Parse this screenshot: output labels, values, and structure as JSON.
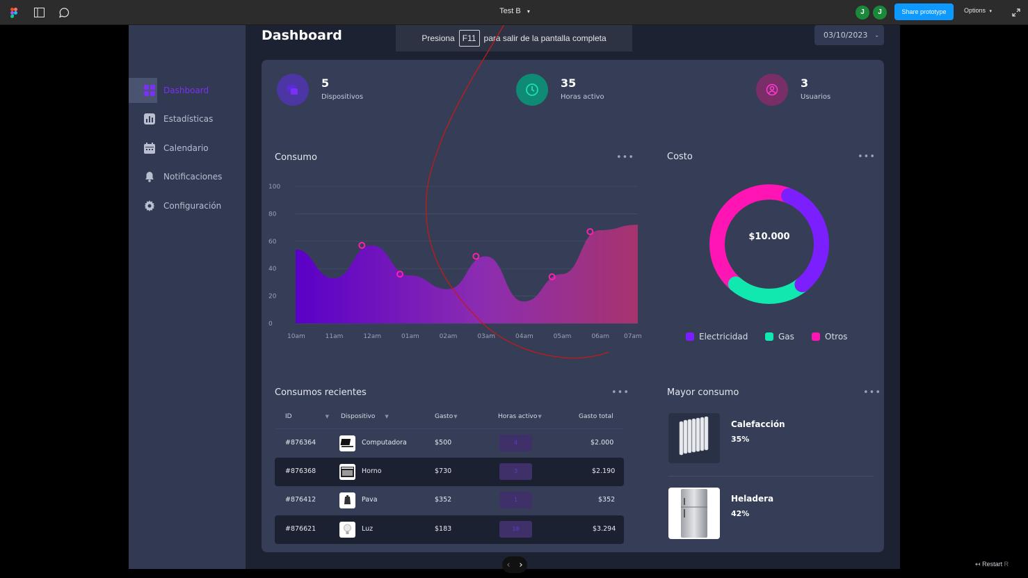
{
  "figma": {
    "file_title": "Test B",
    "share_label": "Share prototype",
    "options_label": "Options",
    "avatars": [
      "J",
      "J"
    ],
    "restart_label": "Restart",
    "restart_key": "R"
  },
  "fullscreen_toast": {
    "before": "Presiona",
    "key": "F11",
    "after": "para salir de la pantalla completa"
  },
  "sidebar": {
    "items": [
      {
        "label": "Dashboard",
        "icon": "grid-icon",
        "active": true
      },
      {
        "label": "Estadísticas",
        "icon": "bar-chart-icon"
      },
      {
        "label": "Calendario",
        "icon": "calendar-icon"
      },
      {
        "label": "Notificaciones",
        "icon": "bell-icon"
      },
      {
        "label": "Configuración",
        "icon": "gear-icon"
      }
    ]
  },
  "header": {
    "title": "Dashboard",
    "date": "03/10/2023"
  },
  "stats": [
    {
      "value": "5",
      "label": "Dispositivos",
      "icon": "devices-icon",
      "color": "#5a2bd6"
    },
    {
      "value": "35",
      "label": "Horas activo",
      "icon": "clock-icon",
      "color": "#16c79a"
    },
    {
      "value": "3",
      "label": "Usuarios",
      "icon": "user-icon",
      "color": "#c11e9d"
    }
  ],
  "consumo": {
    "title": "Consumo",
    "more": "•••"
  },
  "costo": {
    "title": "Costo",
    "more": "•••",
    "total": "$10.000"
  },
  "recientes": {
    "title": "Consumos recientes",
    "more": "•••",
    "headers": [
      "ID",
      "Dispositivo",
      "Gasto",
      "Horas activo",
      "Gasto total"
    ],
    "rows": [
      {
        "id": "#876364",
        "device": "Computadora",
        "gasto": "$500",
        "horas": "4",
        "total": "$2.000",
        "icon": "laptop-icon"
      },
      {
        "id": "#876368",
        "device": "Horno",
        "gasto": "$730",
        "horas": "3",
        "total": "$2.190",
        "icon": "oven-icon"
      },
      {
        "id": "#876412",
        "device": "Pava",
        "gasto": "$352",
        "horas": "1",
        "total": "$352",
        "icon": "kettle-icon"
      },
      {
        "id": "#876621",
        "device": "Luz",
        "gasto": "$183",
        "horas": "18",
        "total": "$3.294",
        "icon": "bulb-icon"
      }
    ]
  },
  "mayor": {
    "title": "Mayor consumo",
    "more": "•••",
    "items": [
      {
        "name": "Calefacción",
        "pct": "35%",
        "icon": "radiator-icon"
      },
      {
        "name": "Heladera",
        "pct": "42%",
        "icon": "fridge-icon"
      }
    ]
  },
  "colors": {
    "accent_purple": "#7b2ff7",
    "electricidad": "#7b1fff",
    "gas": "#11e8b0",
    "otros": "#ff15b4",
    "line_points": "#ff1fb0"
  },
  "chart_data": [
    {
      "type": "area",
      "title": "Consumo",
      "x": [
        "10am",
        "11am",
        "12am",
        "01am",
        "02am",
        "03am",
        "04am",
        "05am",
        "06am",
        "07am"
      ],
      "series": [
        {
          "values": [
            54,
            33,
            57,
            35,
            25,
            49,
            16,
            36,
            68,
            72
          ]
        }
      ],
      "markers": [
        {
          "x": "12am",
          "y": 57
        },
        {
          "x": "01am",
          "y": 36
        },
        {
          "x": "03am",
          "y": 49
        },
        {
          "x": "05am",
          "y": 34
        },
        {
          "x": "06am",
          "y": 67
        }
      ],
      "ylim": [
        0,
        100
      ],
      "yticks": [
        0,
        20,
        40,
        60,
        80,
        100
      ],
      "grid": true
    },
    {
      "type": "pie",
      "title": "Costo",
      "center_label": "$10.000",
      "categories": [
        "Electricidad",
        "Gas",
        "Otros"
      ],
      "values": [
        33,
        22,
        45
      ],
      "legend": "bottom"
    }
  ]
}
